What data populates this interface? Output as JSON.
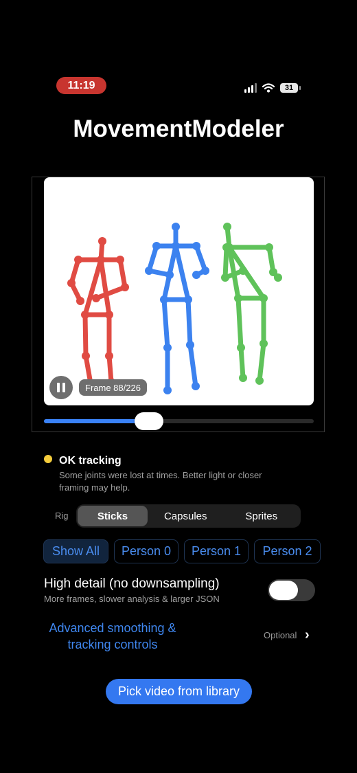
{
  "status_bar": {
    "time": "11:19",
    "battery": "31",
    "icons": [
      "cellular-signal-icon",
      "wifi-icon",
      "battery-icon"
    ]
  },
  "app": {
    "title": "MovementModeler"
  },
  "player": {
    "frame_label": "Frame 88/226",
    "frame_current": 88,
    "frame_total": 226,
    "progress": 0.39,
    "state": "playing",
    "skeleton_colors": {
      "person0": "#e04b43",
      "person1": "#3c82ef",
      "person2": "#5fc25a"
    }
  },
  "tracking": {
    "status_color": "#f5cd3c",
    "title": "OK tracking",
    "description": "Some joints were lost at times. Better light or closer framing may help."
  },
  "rig": {
    "label": "Rig",
    "options": [
      "Sticks",
      "Capsules",
      "Sprites"
    ],
    "selected": "Sticks"
  },
  "person_filter": {
    "options": [
      "Show All",
      "Person 0",
      "Person 1",
      "Person 2"
    ],
    "selected": "Show All"
  },
  "high_detail": {
    "title": "High detail (no downsampling)",
    "description": "More frames, slower analysis & larger JSON",
    "enabled": false
  },
  "advanced": {
    "label": "Advanced smoothing & tracking controls",
    "badge": "Optional"
  },
  "actions": {
    "pick_video": "Pick video from library"
  },
  "colors": {
    "accent": "#3478f0",
    "background": "#000000"
  }
}
